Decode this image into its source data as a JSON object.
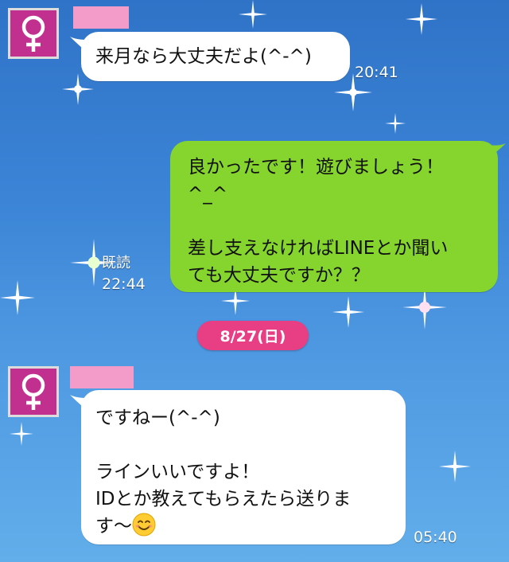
{
  "messages": [
    {
      "side": "left",
      "lines": [
        "来月なら大丈夫だよ(^-^)"
      ],
      "time": "20:41"
    },
    {
      "side": "right",
      "lines": [
        "良かったです！遊びましょう！",
        "^_^",
        "",
        "差し支えなければLINEとか聞い",
        "ても大丈夫ですか？？"
      ],
      "read_label": "既読",
      "time": "22:44"
    },
    {
      "side": "left",
      "lines": [
        "ですねー(^-^)",
        "",
        "ラインいいですよ！",
        "IDとか教えてもらえたら送りま",
        "す〜"
      ],
      "emoji": "smiling-face-emoji",
      "time": "05:40"
    }
  ],
  "date_separator": "8/27(日)",
  "avatar_icon": "female-symbol-icon",
  "colors": {
    "background_top": "#2f73c7",
    "background_bottom": "#62aeea",
    "incoming_bubble": "#ffffff",
    "outgoing_bubble": "#86d42e",
    "avatar": "#c2308f",
    "date_pill": "#e83f84",
    "name_mask": "#f49cc9"
  }
}
